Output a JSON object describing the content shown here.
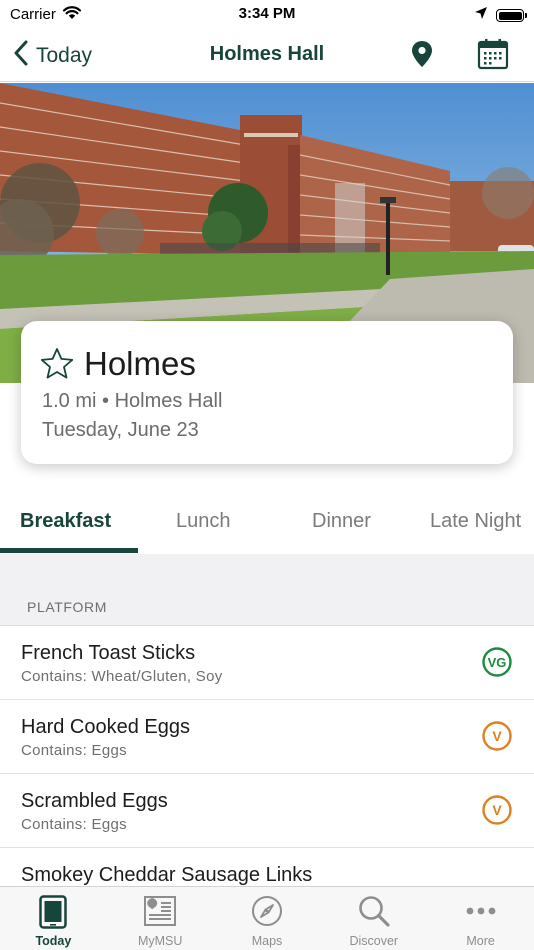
{
  "status_bar": {
    "carrier": "Carrier",
    "time": "3:34 PM"
  },
  "nav": {
    "back_label": "Today",
    "title": "Holmes Hall"
  },
  "card": {
    "name": "Holmes",
    "distance_location": "1.0 mi • Holmes Hall",
    "date": "Tuesday, June 23"
  },
  "tabs": [
    {
      "label": "Breakfast",
      "active": true
    },
    {
      "label": "Lunch",
      "active": false
    },
    {
      "label": "Dinner",
      "active": false
    },
    {
      "label": "Late Night",
      "active": false
    }
  ],
  "menu": {
    "section": "PLATFORM",
    "items": [
      {
        "name": "French Toast Sticks",
        "allergens": "Contains: Wheat/Gluten, Soy",
        "badge": "VG",
        "badge_color": "#1e8a3f"
      },
      {
        "name": "Hard Cooked Eggs",
        "allergens": "Contains: Eggs",
        "badge": "V",
        "badge_color": "#e07f22"
      },
      {
        "name": "Scrambled Eggs",
        "allergens": "Contains: Eggs",
        "badge": "V",
        "badge_color": "#e07f22"
      },
      {
        "name": "Smokey Cheddar Sausage Links",
        "allergens": "",
        "badge": "",
        "badge_color": ""
      }
    ]
  },
  "tab_bar": [
    {
      "label": "Today",
      "icon": "today-icon",
      "active": true
    },
    {
      "label": "MyMSU",
      "icon": "newspaper-icon",
      "active": false
    },
    {
      "label": "Maps",
      "icon": "compass-icon",
      "active": false
    },
    {
      "label": "Discover",
      "icon": "search-icon",
      "active": false
    },
    {
      "label": "More",
      "icon": "more-icon",
      "active": false
    }
  ],
  "colors": {
    "brand_green": "#18453b",
    "vegan_green": "#1e8a3f",
    "vegetarian_orange": "#e07f22"
  }
}
